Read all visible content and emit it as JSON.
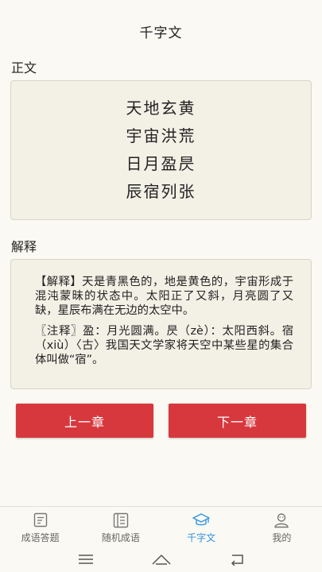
{
  "header": {
    "title": "千字文"
  },
  "main_section": {
    "label": "正文",
    "lines": [
      "天地玄黄",
      "宇宙洪荒",
      "日月盈昃",
      "辰宿列张"
    ]
  },
  "explanation_section": {
    "label": "解释",
    "paragraphs": [
      "【解释】天是青黑色的，地是黄色的，宇宙形成于混沌蒙昧的状态中。太阳正了又斜，月亮圆了又缺，星辰布满在无边的太空中。",
      "〖注释〗盈：月光圆满。昃（zè）：太阳西斜。宿（xiù）〈古〉我国天文学家将天空中某些星的集合体叫做“宿”。"
    ]
  },
  "buttons": {
    "prev": "上一章",
    "next": "下一章"
  },
  "tabs": [
    {
      "label": "成语答题",
      "icon": "quiz-icon",
      "active": false
    },
    {
      "label": "随机成语",
      "icon": "random-book-icon",
      "active": false
    },
    {
      "label": "千字文",
      "icon": "graduation-cap-icon",
      "active": true
    },
    {
      "label": "我的",
      "icon": "profile-icon",
      "active": false
    }
  ],
  "colors": {
    "accent": "#2f93df",
    "button": "#d7383d",
    "background": "#fbf9f3",
    "card": "#f3f0e6"
  },
  "system_nav": {
    "icons": [
      "menu-icon",
      "home-icon",
      "back-icon"
    ]
  }
}
